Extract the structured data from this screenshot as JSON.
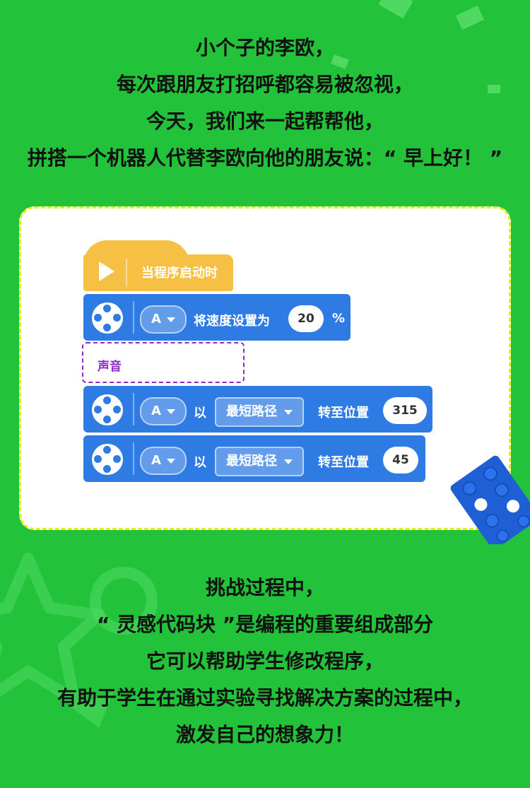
{
  "intro_lines": [
    "小个子的李欧，",
    "每次跟朋友打招呼都容易被忽视，",
    "今天，我们来一起帮帮他，",
    "拼搭一个机器人代替李欧向他的朋友说：“ 早上好！ ”"
  ],
  "blocks": {
    "hat_label": "当程序启动时",
    "speed": {
      "port": "A",
      "label": "将速度设置为",
      "value": "20",
      "unit": "%"
    },
    "sound_label": "声音",
    "turn1": {
      "port": "A",
      "prefix": "以",
      "direction": "最短路径",
      "label": "转至位置",
      "value": "315"
    },
    "turn2": {
      "port": "A",
      "prefix": "以",
      "direction": "最短路径",
      "label": "转至位置",
      "value": "45"
    }
  },
  "outro_lines": [
    "挑战过程中，",
    "“ 灵感代码块 ”是编程的重要组成部分",
    "它可以帮助学生修改程序，",
    "有助于学生在通过实验寻找解决方案的过程中，",
    "激发自己的想象力！"
  ],
  "colors": {
    "background": "#22c33a",
    "event_block": "#f5c043",
    "motor_block": "#2f7be4",
    "sound_block": "#8c2cc6",
    "card_border": "#e6ee1a"
  },
  "icons": [
    "play-icon",
    "motor-icon",
    "lego-brick-icon",
    "star-outline-icon",
    "circle-outline-icon"
  ]
}
